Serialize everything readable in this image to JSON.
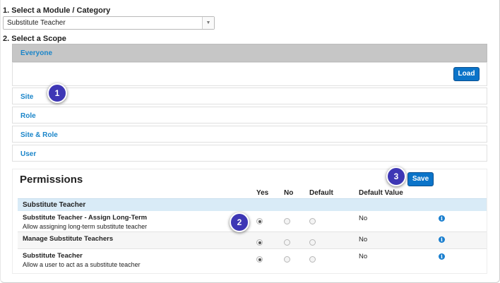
{
  "module_section": {
    "label": "1. Select a Module / Category",
    "selected_value": "Substitute Teacher"
  },
  "scope_section": {
    "label": "2. Select a Scope",
    "header": "Everyone",
    "load_label": "Load",
    "items": [
      "Site",
      "Role",
      "Site & Role",
      "User"
    ]
  },
  "permissions": {
    "title": "Permissions",
    "save_label": "Save",
    "columns": [
      "Yes",
      "No",
      "Default",
      "Default Value"
    ],
    "group": "Substitute Teacher",
    "rows": [
      {
        "name": "Substitute Teacher - Assign Long-Term",
        "description": "Allow assigning long-term substitute teacher",
        "selected": "Yes",
        "default_value": "No"
      },
      {
        "name": "Manage Substitute Teachers",
        "description": "",
        "selected": "Yes",
        "default_value": "No"
      },
      {
        "name": "Substitute Teacher",
        "description": "Allow a user to act as a substitute teacher",
        "selected": "Yes",
        "default_value": "No"
      }
    ]
  },
  "callouts": [
    "1",
    "2",
    "3"
  ],
  "colors": {
    "accent": "#0b74c9",
    "link": "#1a85c9",
    "callout": "#3e37b5",
    "group_row": "#d9ebf7",
    "scope_header": "#c6c6c6"
  },
  "icons": {
    "select_arrow": "chevron-down-icon",
    "info": "info-icon"
  }
}
